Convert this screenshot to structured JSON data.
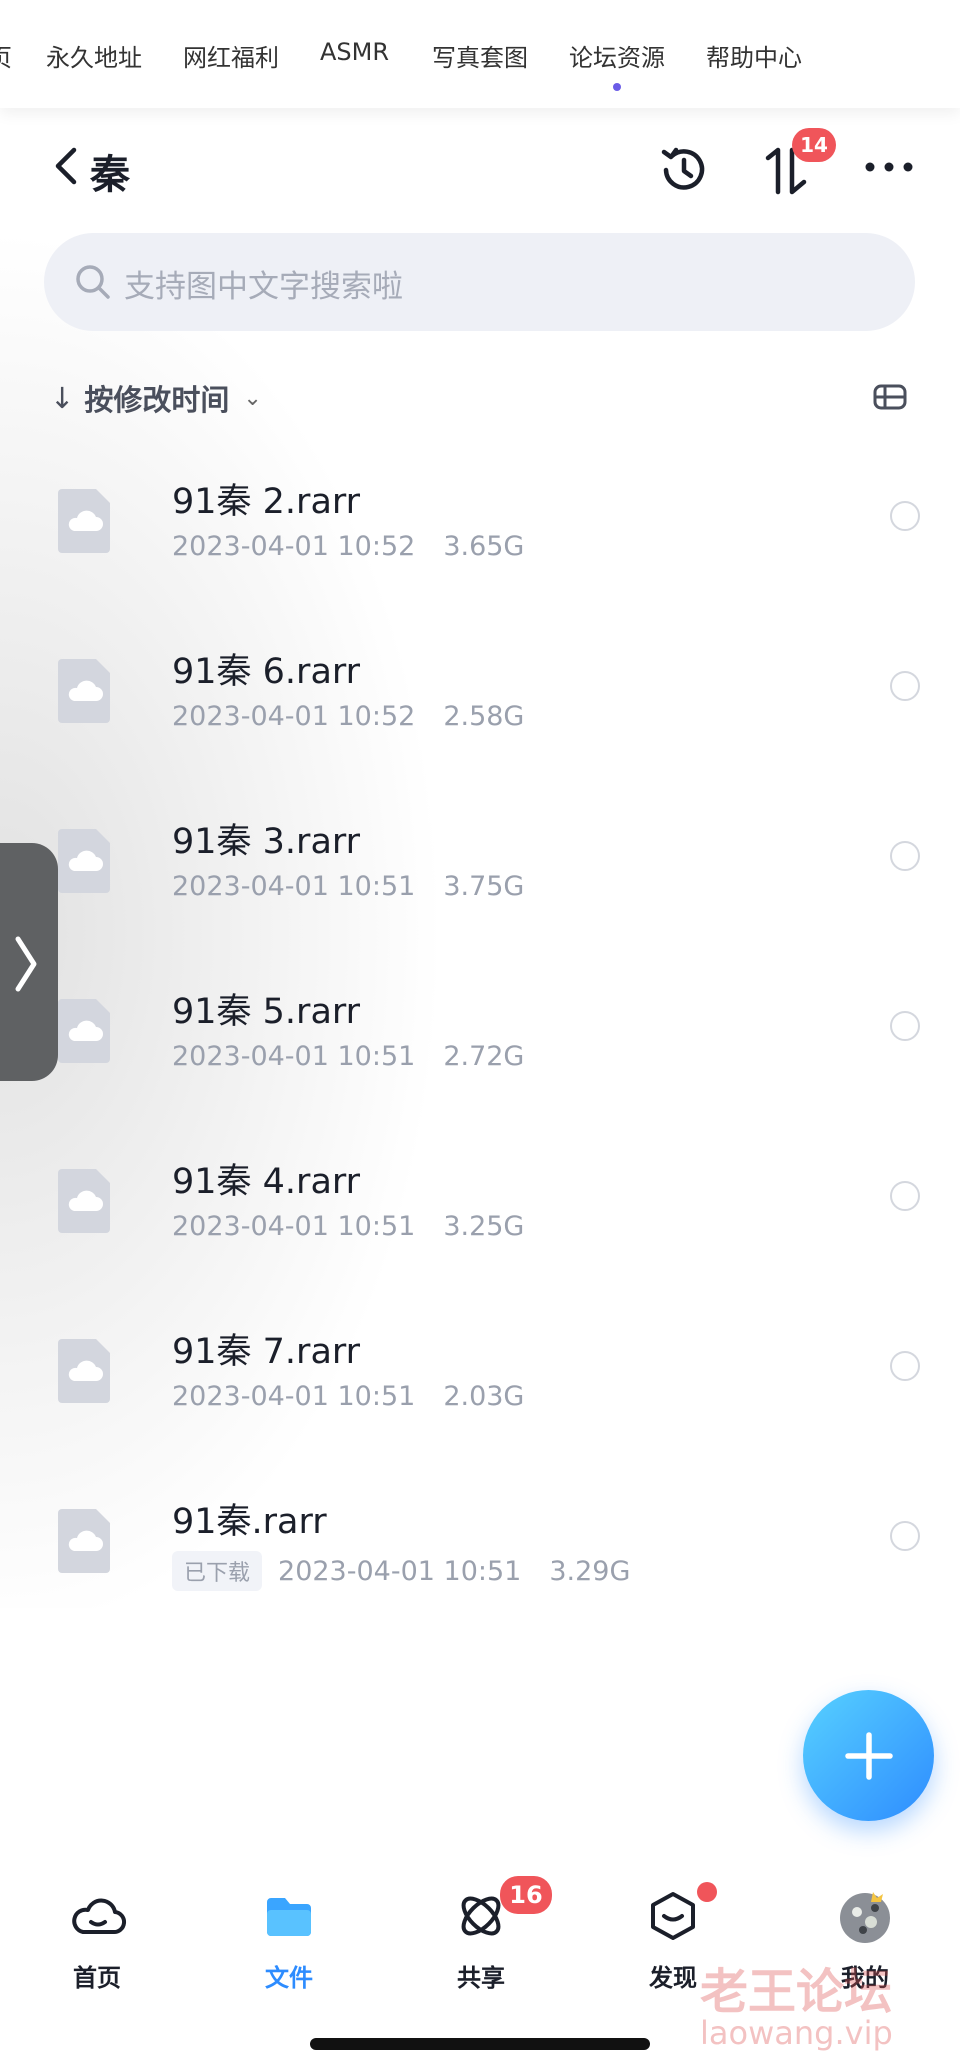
{
  "topnav": {
    "items": [
      "页",
      "永久地址",
      "网红福利",
      "ASMR",
      "写真套图",
      "论坛资源",
      "帮助中心"
    ],
    "active_index": 5
  },
  "header": {
    "title": "秦",
    "transfer_badge": "14"
  },
  "search": {
    "placeholder": "支持图中文字搜索啦"
  },
  "sort": {
    "label": "按修改时间"
  },
  "files": [
    {
      "name": "91秦 2.rarr",
      "date": "2023-04-01 10:52",
      "size": "3.65G",
      "tag": ""
    },
    {
      "name": "91秦 6.rarr",
      "date": "2023-04-01 10:52",
      "size": "2.58G",
      "tag": ""
    },
    {
      "name": "91秦 3.rarr",
      "date": "2023-04-01 10:51",
      "size": "3.75G",
      "tag": ""
    },
    {
      "name": "91秦 5.rarr",
      "date": "2023-04-01 10:51",
      "size": "2.72G",
      "tag": ""
    },
    {
      "name": "91秦 4.rarr",
      "date": "2023-04-01 10:51",
      "size": "3.25G",
      "tag": ""
    },
    {
      "name": "91秦 7.rarr",
      "date": "2023-04-01 10:51",
      "size": "2.03G",
      "tag": ""
    },
    {
      "name": "91秦.rarr",
      "date": "2023-04-01 10:51",
      "size": "3.29G",
      "tag": "已下载"
    }
  ],
  "tabbar": {
    "items": [
      {
        "label": "首页",
        "icon": "cloud-home-icon"
      },
      {
        "label": "文件",
        "icon": "folder-icon"
      },
      {
        "label": "共享",
        "icon": "share-orbit-icon",
        "badge": "16"
      },
      {
        "label": "发现",
        "icon": "discover-box-icon"
      },
      {
        "label": "我的",
        "icon": "avatar"
      }
    ],
    "active_index": 1
  },
  "watermark": {
    "line1": "老王论坛",
    "line2": "laowang.vip"
  },
  "colors": {
    "accent": "#2d8cff",
    "badge": "#f0555a",
    "nav_dot": "#6b5ce7"
  }
}
